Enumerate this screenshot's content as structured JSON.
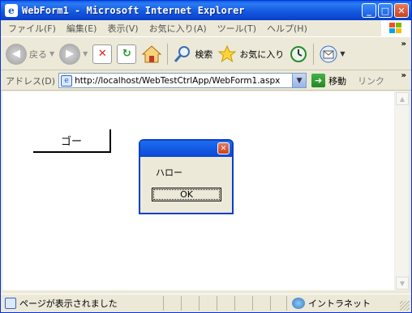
{
  "window": {
    "title": "WebForm1 - Microsoft Internet Explorer",
    "controls": {
      "minimize": "_",
      "maximize": "□",
      "close": "✕"
    }
  },
  "menubar": {
    "items": [
      "ファイル(F)",
      "編集(E)",
      "表示(V)",
      "お気に入り(A)",
      "ツール(T)",
      "ヘルプ(H)"
    ]
  },
  "toolbar": {
    "back_label": "戻る",
    "search_label": "検索",
    "favorites_label": "お気に入り",
    "icons": [
      "back-icon",
      "forward-icon",
      "stop-icon",
      "refresh-icon",
      "home-icon",
      "search-icon",
      "favorites-icon",
      "history-icon",
      "mail-icon"
    ]
  },
  "addressbar": {
    "label": "アドレス(D)",
    "url": "http://localhost/WebTestCtrlApp/WebForm1.aspx",
    "go_label": "移動",
    "links_label": "リンク"
  },
  "page": {
    "button_label": "ゴー"
  },
  "dialog": {
    "message": "ハロー",
    "ok_label": "OK"
  },
  "statusbar": {
    "text": "ページが表示されました",
    "zone": "イントラネット"
  },
  "colors": {
    "titlebar": "#0A5FE8",
    "chrome": "#ECE9D8",
    "border": "#0831D9"
  }
}
